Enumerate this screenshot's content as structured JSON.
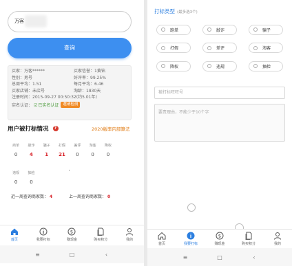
{
  "left": {
    "search_value": "万客",
    "search_button": "查询",
    "info": {
      "buyer_label": "买家：",
      "buyer_value": "万客******",
      "credit_label": "买家信誉：",
      "credit_value": "1黄钻",
      "gender_label": "性别：",
      "gender_value": "男号",
      "rate_label": "好评率：",
      "rate_value": "99.25%",
      "total_avg_label": "总周平均：",
      "total_avg_value": "1.51",
      "weekly_avg_label": "每月平均：",
      "weekly_avg_value": "6.46",
      "shop_label": "买家店铺：",
      "shop_value": "未店号",
      "age_label": "淘龄：",
      "age_value": "1830天",
      "reg_label": "注册时间：",
      "reg_value": "2015-09-27 00:50:32(约5.01年)",
      "verify_label": "实名认证：",
      "verify_value": "已实名认证",
      "verify_badge": "邀请检测"
    },
    "section_title": "用户被打标情况",
    "section_link": "2020版率内部算法",
    "grid_row1_heads": [
      "商单",
      "敲诈",
      "骗子",
      "打假",
      "差评",
      "淘客",
      "降权"
    ],
    "grid_row1_vals": [
      "0",
      "4",
      "1",
      "21",
      "0",
      "0",
      "0"
    ],
    "grid_row2_heads": [
      "违规",
      "抽检"
    ],
    "grid_row2_vals": [
      "0",
      "0"
    ],
    "recent1_label": "近一周查询商家数：",
    "recent1_value": "4",
    "recent2_label": "上一周查询商家数：",
    "recent2_value": "0"
  },
  "right": {
    "type_title": "打标类型",
    "type_sub": "(最多选3个)",
    "types": [
      [
        "跑单",
        "敲诈",
        "骗子"
      ],
      [
        "打假",
        "差评",
        "淘客"
      ],
      [
        "降权",
        "违规",
        "抽检"
      ]
    ],
    "ww_placeholder": "被打标旺旺号",
    "reason_placeholder": "要责理由，不能少于10个字"
  },
  "tabs": [
    "首页",
    "我要打标",
    "赚现金",
    "购买积分",
    "我的"
  ],
  "nav": [
    "≡",
    "□",
    "‹"
  ],
  "colors": {
    "primary": "#3d8ff0",
    "active_tab": "#2c7fe0",
    "red": "#d6181f",
    "orange": "#f08a24",
    "green": "#4a9a3a"
  }
}
